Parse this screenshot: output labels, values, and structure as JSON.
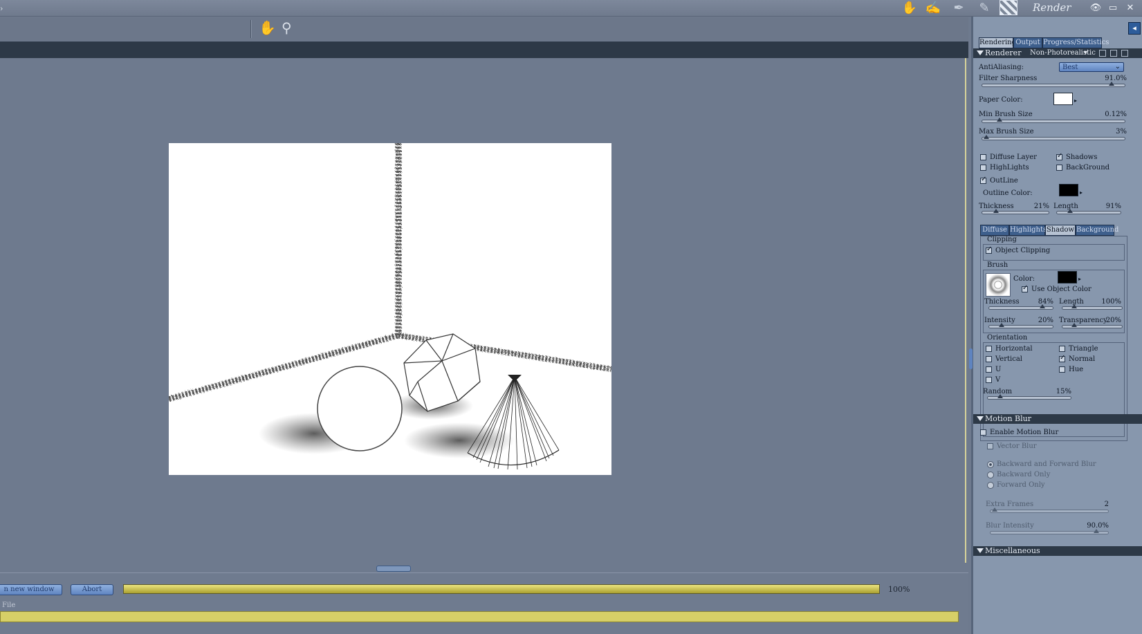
{
  "window": {
    "title": "Render"
  },
  "toolbar": {
    "tools": [
      {
        "icon": "hand-figure-icon"
      },
      {
        "icon": "sketch-brush-icon"
      },
      {
        "icon": "pen-icon"
      },
      {
        "icon": "quill-icon"
      },
      {
        "icon": "film-render-icon"
      }
    ],
    "pan_icon": "hand-pan-icon",
    "zoom_icon": "magnifier-icon"
  },
  "bottom": {
    "new_window_label": "n new window",
    "abort_label": "Abort",
    "progress": 100,
    "progress_label": "100%",
    "file_label": "File"
  },
  "panel": {
    "tabs": [
      {
        "label": "Rendering",
        "active": true
      },
      {
        "label": "Output",
        "active": false
      },
      {
        "label": "Progress/Statistics",
        "active": false
      }
    ],
    "renderer": {
      "label": "Renderer",
      "value": "Non-Photorealistic"
    },
    "antialiasing": {
      "label": "AntiAliasing:",
      "value": "Best"
    },
    "filter_sharpness": {
      "label": "Filter Sharpness",
      "value": "91.0%",
      "level": 0.91
    },
    "paper_color": {
      "label": "Paper Color:",
      "color": "#ffffff"
    },
    "min_brush": {
      "label": "Min Brush Size",
      "value": "0.12%",
      "level": 0.12
    },
    "max_brush": {
      "label": "Max Brush Size",
      "value": "3%",
      "level": 0.03
    },
    "checks": {
      "diffuse": {
        "label": "Diffuse Layer",
        "checked": false
      },
      "shadows": {
        "label": "Shadows",
        "checked": true
      },
      "highlights": {
        "label": "HighLights",
        "checked": false
      },
      "background": {
        "label": "BackGround",
        "checked": false
      },
      "outline": {
        "label": "OutLine",
        "checked": true
      }
    },
    "outline_color": {
      "label": "Outline Color:",
      "color": "#000000"
    },
    "thickness": {
      "label": "Thickness",
      "value": "21%",
      "level": 0.21
    },
    "length": {
      "label": "Length",
      "value": "91%",
      "level": 0.21
    },
    "subtabs": [
      {
        "label": "Diffuse",
        "active": false
      },
      {
        "label": "Highlights",
        "active": false
      },
      {
        "label": "Shadow",
        "active": true
      },
      {
        "label": "Background",
        "active": false
      }
    ],
    "clipping": {
      "title": "Clipping",
      "object_clipping": {
        "label": "Object Clipping",
        "checked": true
      }
    },
    "brush": {
      "title": "Brush",
      "color_label": "Color:",
      "color": "#000000",
      "use_object_color": {
        "label": "Use Object Color",
        "checked": true
      },
      "thickness": {
        "label": "Thickness",
        "value": "84%",
        "level": 0.84
      },
      "length": {
        "label": "Length",
        "value": "100%",
        "level": 0.2
      },
      "intensity": {
        "label": "Intensity",
        "value": "20%",
        "level": 0.2
      },
      "transparency": {
        "label": "Transparency",
        "value": "20%",
        "level": 0.2
      }
    },
    "orientation": {
      "title": "Orientation",
      "horizontal": {
        "label": "Horizontal",
        "checked": false
      },
      "triangle": {
        "label": "Triangle",
        "checked": false
      },
      "vertical": {
        "label": "Vertical",
        "checked": false
      },
      "normal": {
        "label": "Normal",
        "checked": true
      },
      "u": {
        "label": "U",
        "checked": false
      },
      "hue": {
        "label": "Hue",
        "checked": false
      },
      "v": {
        "label": "V",
        "checked": false
      },
      "random": {
        "label": "Random",
        "value": "15%",
        "level": 0.15
      }
    },
    "motion_blur": {
      "title": "Motion Blur",
      "enable": {
        "label": "Enable Motion Blur",
        "checked": false
      },
      "vector": {
        "label": "Vector Blur",
        "checked": false
      },
      "backfwd": "Backward and Forward Blur",
      "back": "Backward Only",
      "fwd": "Forward Only",
      "extra_frames": {
        "label": "Extra Frames",
        "value": "2"
      },
      "blur_intensity": {
        "label": "Blur Intensity",
        "value": "90.0%",
        "level": 0.9
      }
    },
    "misc": {
      "title": "Miscellaneous"
    }
  },
  "colors": {
    "accent": "#2d3947",
    "panel": "#8797ad",
    "progress": "#d6cf67"
  }
}
